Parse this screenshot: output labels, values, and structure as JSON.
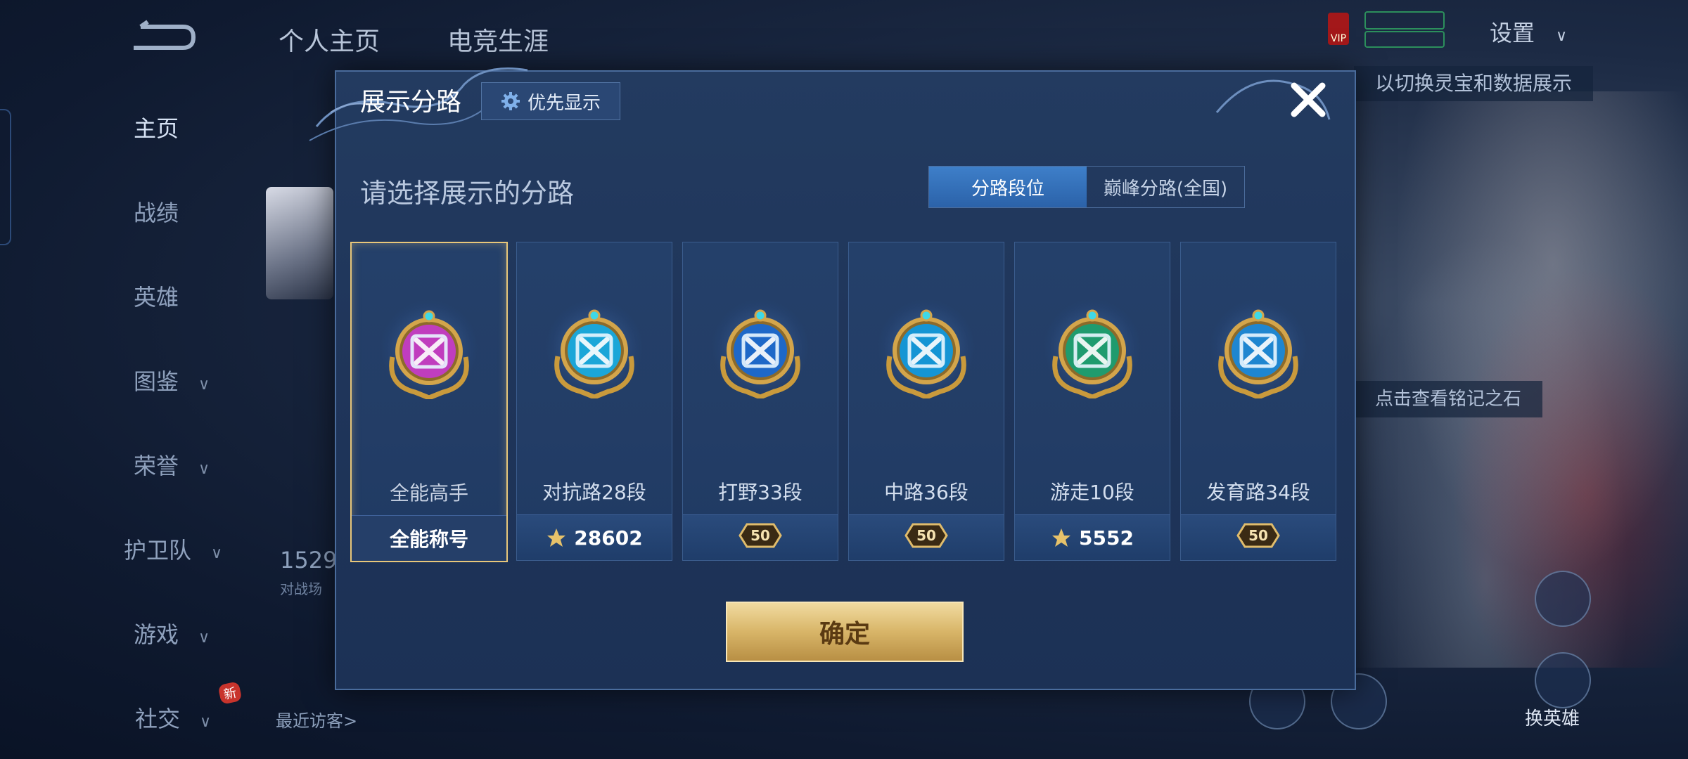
{
  "background": {
    "tabs": [
      "个人主页",
      "电竞生涯"
    ],
    "sidebar": [
      {
        "label": "主页",
        "active": true,
        "chevron": false
      },
      {
        "label": "战绩",
        "active": false,
        "chevron": false
      },
      {
        "label": "英雄",
        "active": false,
        "chevron": false
      },
      {
        "label": "图鉴",
        "active": false,
        "chevron": true
      },
      {
        "label": "荣誉",
        "active": false,
        "chevron": true
      },
      {
        "label": "护卫队",
        "active": false,
        "chevron": true
      },
      {
        "label": "游戏",
        "active": false,
        "chevron": true
      },
      {
        "label": "社交",
        "active": false,
        "chevron": true
      }
    ],
    "new_badge": "新",
    "settings_label": "设置",
    "stat_value": "1529",
    "stat_caption": "对战场",
    "recent_visitors": "最近访客>",
    "hint_top": "以切换灵宝和数据展示",
    "hint_mid": "点击查看铭记之石",
    "swap_hero": "换英雄"
  },
  "dialog": {
    "title": "展示分路",
    "priority_button": "优先显示",
    "subtitle": "请选择展示的分路",
    "segments": [
      {
        "label": "分路段位",
        "selected": true
      },
      {
        "label": "巅峰分路(全国)",
        "selected": false
      }
    ],
    "lanes": [
      {
        "name": "全能高手",
        "footer": "全能称号",
        "footer_type": "text",
        "selected": true,
        "color": "#c03dbe"
      },
      {
        "name": "对抗路28段",
        "footer": "28602",
        "footer_type": "score",
        "selected": false,
        "color": "#1ba6d8"
      },
      {
        "name": "打野33段",
        "footer": "50",
        "footer_type": "level",
        "selected": false,
        "color": "#1e68c8"
      },
      {
        "name": "中路36段",
        "footer": "50",
        "footer_type": "level",
        "selected": false,
        "color": "#1595d4"
      },
      {
        "name": "游走10段",
        "footer": "5552",
        "footer_type": "score",
        "selected": false,
        "color": "#1f9b6e"
      },
      {
        "name": "发育路34段",
        "footer": "50",
        "footer_type": "level",
        "selected": false,
        "color": "#1f86d0"
      }
    ],
    "confirm_button": "确定"
  },
  "colors": {
    "accent_gold": "#e8c77a",
    "segment_active": "#3e7fc9"
  }
}
